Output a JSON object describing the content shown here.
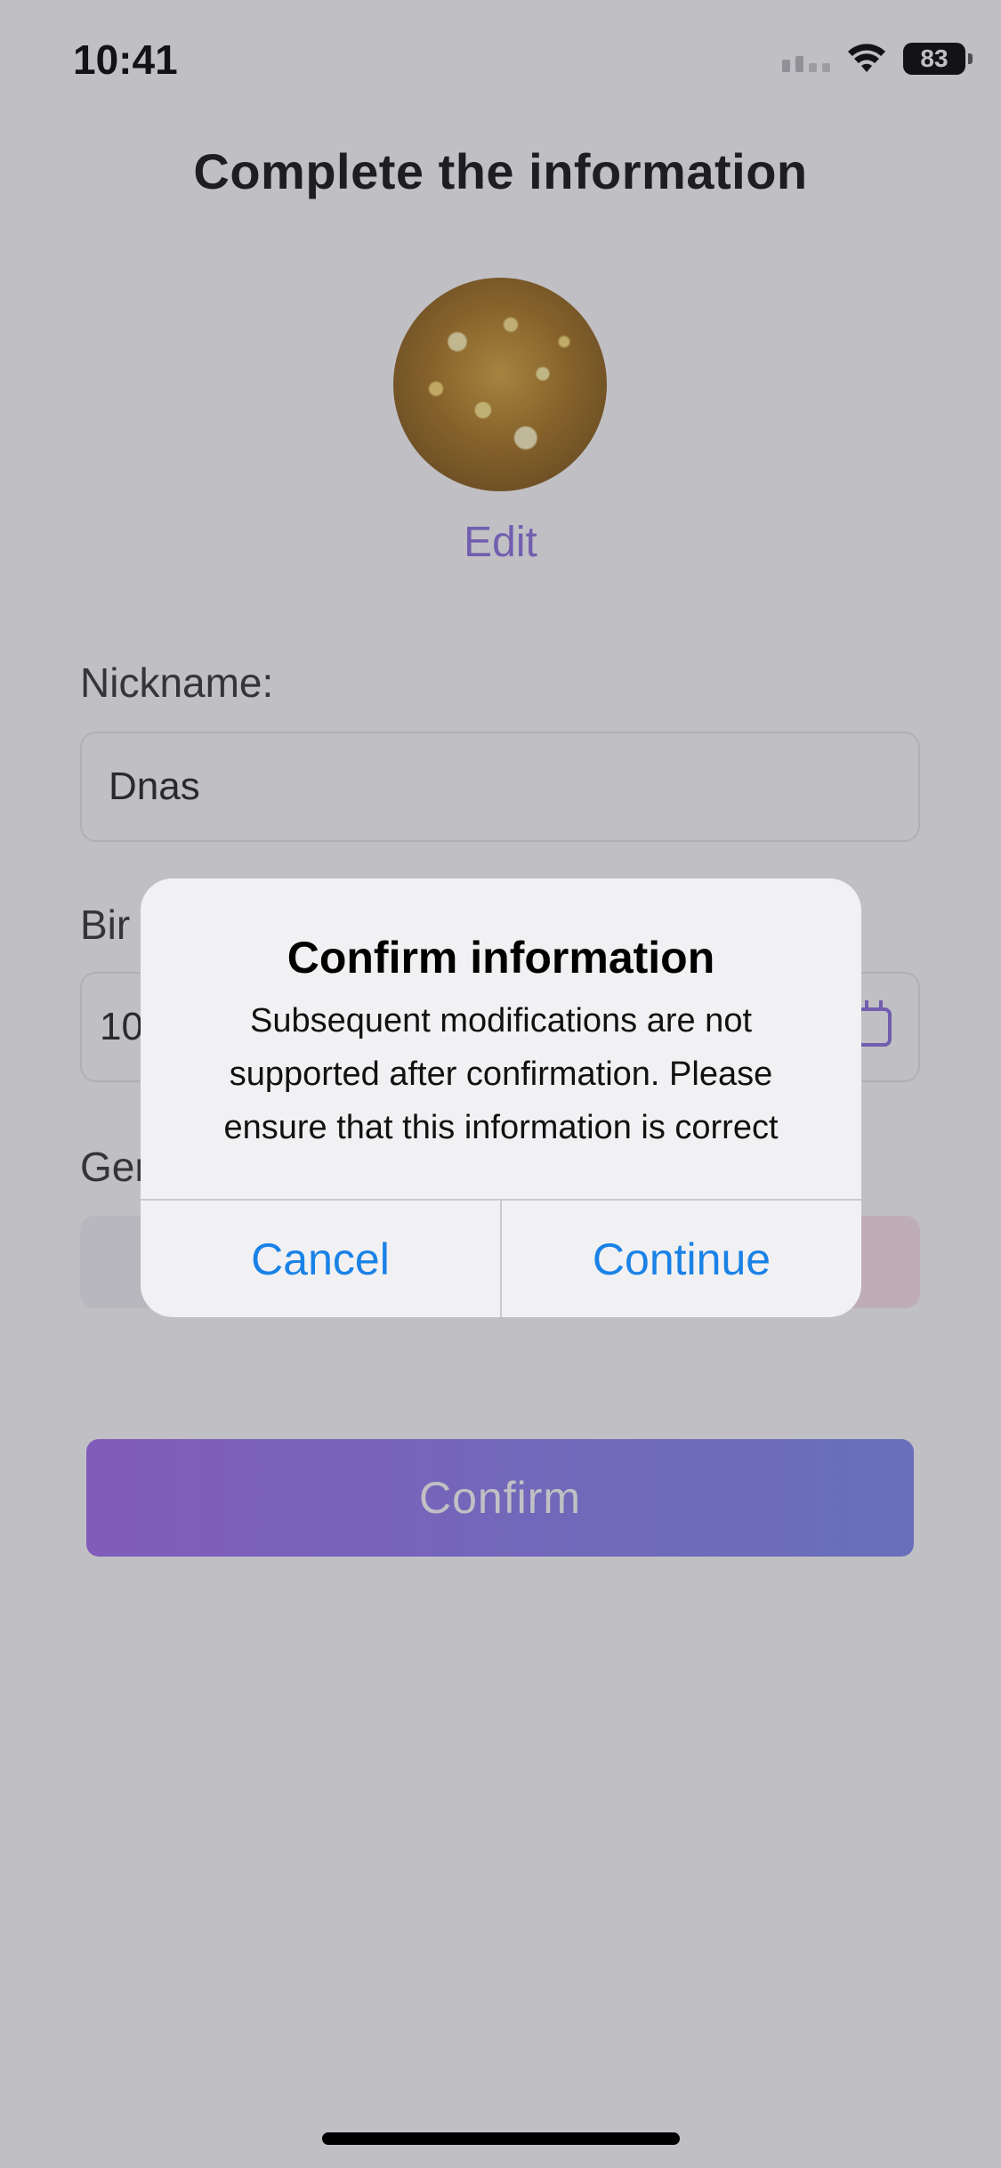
{
  "status_bar": {
    "time": "10:41",
    "battery": "83",
    "icons": [
      "signal-icon",
      "wifi-icon",
      "battery-icon"
    ]
  },
  "page": {
    "title": "Complete the information",
    "avatar_edit": "Edit"
  },
  "form": {
    "nickname_label": "Nickname:",
    "nickname_value": "Dnas",
    "birthday_label_visible": "Bir",
    "birthday_value_visible": "10.",
    "gender_label_visible": "Ger"
  },
  "confirm_button_label": "Confirm",
  "alert": {
    "title": "Confirm information",
    "message": "Subsequent modifications are not supported after confirmation. Please ensure that this information is correct",
    "cancel_label": "Cancel",
    "continue_label": "Continue"
  },
  "colors": {
    "accent": "#8b6fe0",
    "alert_button": "#1a82e6"
  }
}
